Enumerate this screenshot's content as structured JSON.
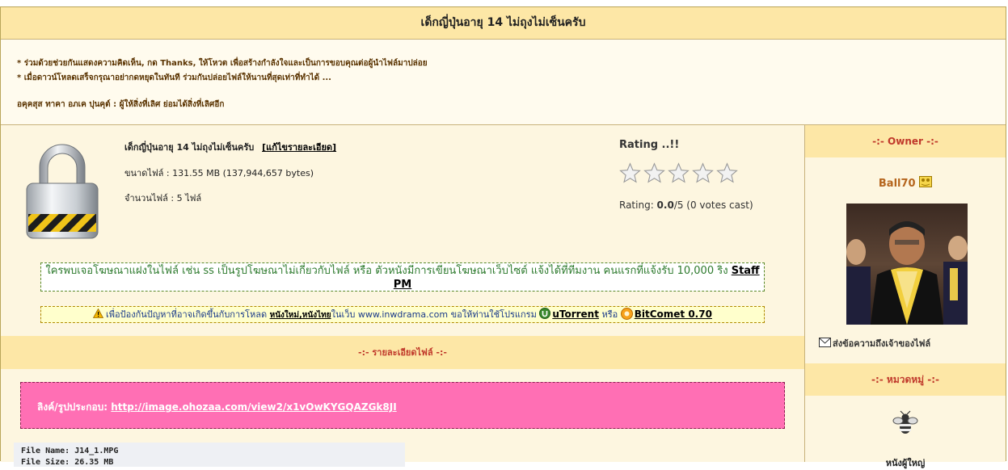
{
  "page": {
    "title": "เด็กญี่ปุ่นอายุ 14 ไม่ถุงไม่เซ็นครับ"
  },
  "notice": {
    "line1": "* ร่วมด้วยช่วยกันแสดงความคิดเห็น, กด Thanks, ให้โหวต เพื่อสร้างกำลังใจและเป็นการขอบคุณต่อผู้นำไฟล์มาปล่อย",
    "line2": "* เมื่อดาวน์โหลดเสร็จกรุณาอย่ากดหยุดในทันที ร่วมกันปล่อยไฟล์ให้นานที่สุดเท่าที่ทำได้ ...",
    "line3": "อคุคสุส ทาคา อภเค ปุนคุต์ : ผู้ให้สิ่งที่เลิศ ย่อมได้สิ่งที่เลิศอีก"
  },
  "file": {
    "name": "เด็กญี่ปุ่นอายุ 14 ไม่ถุงไม่เซ็นครับ",
    "edit_link": "[แก้ไขรายละเอียด]",
    "size_label": "ขนาดไฟล์ : 131.55 MB (137,944,657 bytes)",
    "count_label": "จำนวนไฟล์ : 5 ไฟล์",
    "lock_icon": "lock-icon"
  },
  "rating": {
    "title": "Rating ..!!",
    "stars_total": 5,
    "stars_filled": 0,
    "text_prefix": "Rating: ",
    "score": "0.0",
    "text_suffix": "/5 (0 votes cast)"
  },
  "ad_notice": {
    "text": "ใครพบเจอโฆษณาแฝงในไฟล์ เช่น ss เป็นรูปโฆษณาไม่เกี่ยวกับไฟล์ หรือ ตัวหนังมีการเขียนโฆษณาเว็บไซต์ แจ้งได้ที่ทีมงาน คนแรกที่แจ้งรับ 10,000 ริง ",
    "link": "Staff PM"
  },
  "warning": {
    "prefix": "เพื่อป้องกันปัญหาที่อาจเกิดขึ้นกับการโหลด ",
    "link1": "หนังใหม่,หนังไทย",
    "middle": "ในเว็บ www.inwdrama.com ขอให้ท่านใช้โปรแกรม ",
    "program1": "uTorrent",
    "or": " หรือ ",
    "program2": "BitComet 0.70"
  },
  "details": {
    "heading": "-:- รายละเอียดไฟล์ -:-",
    "image_label": "ลิงค์/รูปประกอบ: ",
    "image_url": "http://image.ohozaa.com/view2/x1vOwKYGQAZGk8JI",
    "file_name_line": "File Name: J14_1.MPG",
    "file_size_line": "File Size: 26.35 MB"
  },
  "sidebar": {
    "owner_heading": "-:- Owner -:-",
    "owner_name": "Ball70",
    "pm_text": "ส่งข้อความถึงเจ้าของไฟล์",
    "category_heading": "-:- หมวดหมู่ -:-",
    "category_name": "หนังผู้ใหญ่"
  },
  "colors": {
    "header_bg": "#fde7a6",
    "panel_bg": "#fdf6e0",
    "pink_box": "#ff6fb4",
    "heading_red": "#c0392b"
  }
}
